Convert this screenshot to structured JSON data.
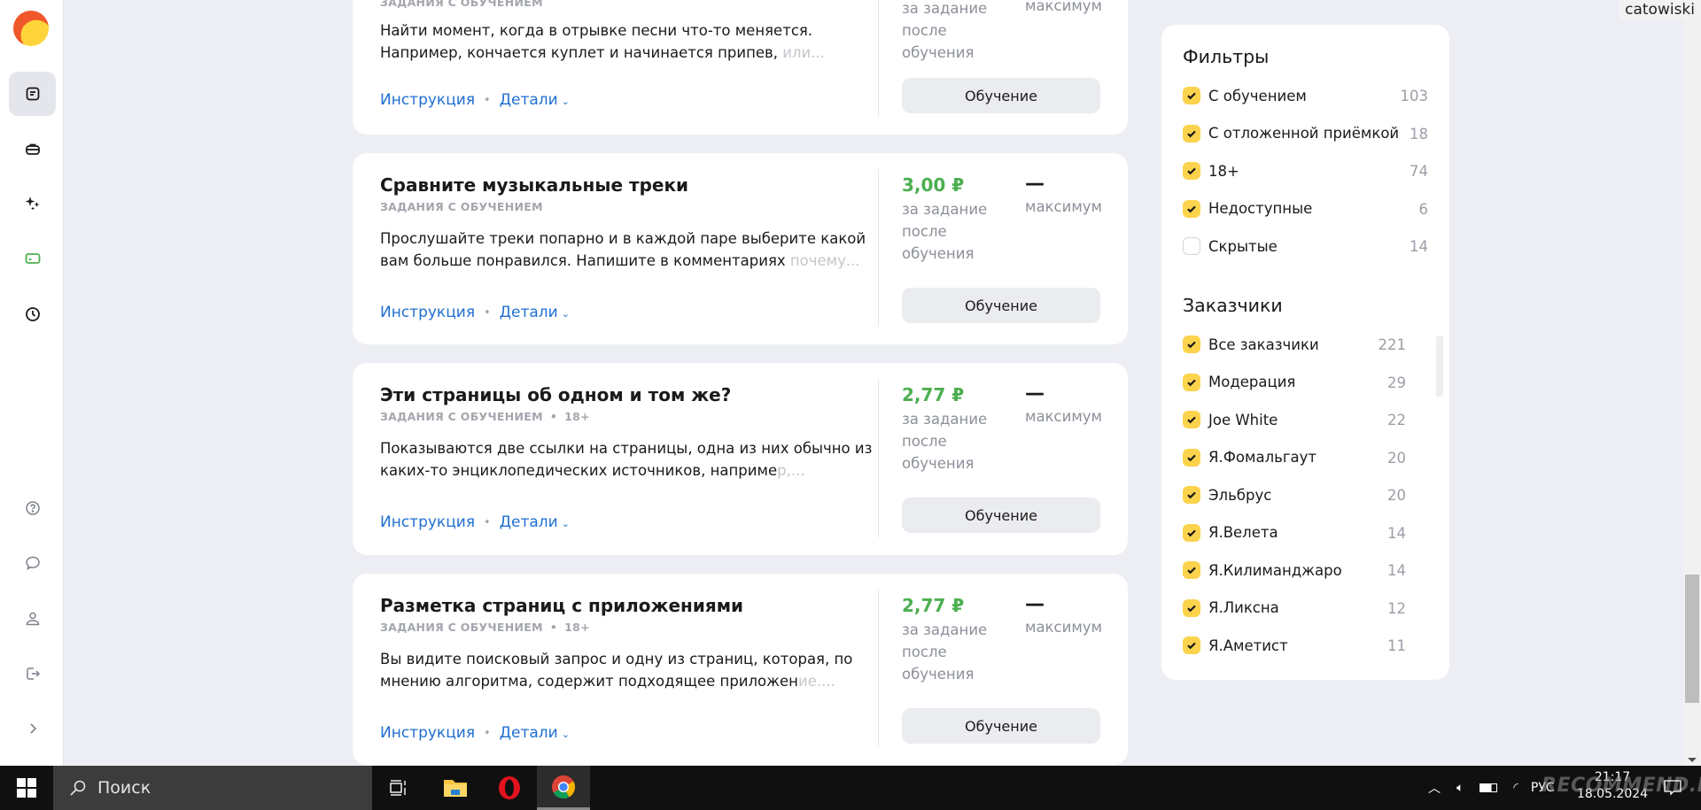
{
  "user": {
    "name": "catowiski"
  },
  "sidebar": {
    "top_items": [
      {
        "name": "tasks",
        "icon": "document-list-icon",
        "active": true
      },
      {
        "name": "portfolio",
        "icon": "briefcase-icon"
      },
      {
        "name": "skills",
        "icon": "sparkles-icon"
      },
      {
        "name": "payments",
        "icon": "credit-card-icon",
        "color": "#4caf50"
      },
      {
        "name": "history",
        "icon": "clock-icon"
      }
    ],
    "bottom_items": [
      {
        "name": "help",
        "icon": "question-circle-icon"
      },
      {
        "name": "messages",
        "icon": "chat-bubble-icon"
      },
      {
        "name": "profile",
        "icon": "user-icon"
      },
      {
        "name": "logout",
        "icon": "logout-icon"
      },
      {
        "name": "expand",
        "icon": "chevron-right-icon"
      }
    ]
  },
  "tasks": [
    {
      "title": "",
      "meta": "ЗАДАНИЯ С ОБУЧЕНИЕМ",
      "age": "",
      "description": "Найти момент, когда в отрывке песни что-то меняется. Например, кончается куплет и начинается припев,",
      "description_fade": " или...",
      "price": "",
      "price_sub": "за задание после обучения",
      "max_value": "",
      "max_label": "максимум",
      "instruction_link": "Инструкция",
      "details_link": "Детали",
      "button": "Обучение"
    },
    {
      "title": "Сравните музыкальные треки",
      "meta": "ЗАДАНИЯ С ОБУЧЕНИЕМ",
      "age": "",
      "description": "Прослушайте треки попарно и в каждой паре выберите какой вам больше понравился. Напишите в комментариях",
      "description_fade": " почему...",
      "price": "3,00 ₽",
      "price_sub": "за задание после обучения",
      "max_value": "—",
      "max_label": "максимум",
      "instruction_link": "Инструкция",
      "details_link": "Детали",
      "button": "Обучение"
    },
    {
      "title": "Эти страницы об одном и том же?",
      "meta": "ЗАДАНИЯ С ОБУЧЕНИЕМ",
      "age": "18+",
      "description": "Показываются две ссылки на страницы, одна из них обычно из каких-то энциклопедических источников, наприме",
      "description_fade": "р,...",
      "price": "2,77 ₽",
      "price_sub": "за задание после обучения",
      "max_value": "—",
      "max_label": "максимум",
      "instruction_link": "Инструкция",
      "details_link": "Детали",
      "button": "Обучение"
    },
    {
      "title": "Разметка страниц с приложениями",
      "meta": "ЗАДАНИЯ С ОБУЧЕНИЕМ",
      "age": "18+",
      "description": "Вы видите поисковый запрос и одну из страниц, которая, по мнению алгоритма, содержит подходящее приложен",
      "description_fade": "ие....",
      "price": "2,77 ₽",
      "price_sub": "за задание после обучения",
      "max_value": "—",
      "max_label": "максимум",
      "instruction_link": "Инструкция",
      "details_link": "Детали",
      "button": "Обучение"
    }
  ],
  "filters": {
    "title": "Фильтры",
    "items": [
      {
        "label": "С обучением",
        "count": "103",
        "checked": true
      },
      {
        "label": "С отложенной приёмкой",
        "count": "18",
        "checked": true
      },
      {
        "label": "18+",
        "count": "74",
        "checked": true
      },
      {
        "label": "Недоступные",
        "count": "6",
        "checked": true
      },
      {
        "label": "Скрытые",
        "count": "14",
        "checked": false
      }
    ]
  },
  "customers": {
    "title": "Заказчики",
    "items": [
      {
        "label": "Все заказчики",
        "count": "221",
        "checked": true
      },
      {
        "label": "Модерация",
        "count": "29",
        "checked": true
      },
      {
        "label": "Joe White",
        "count": "22",
        "checked": true
      },
      {
        "label": "Я.Фомальгаут",
        "count": "20",
        "checked": true
      },
      {
        "label": "Эльбрус",
        "count": "20",
        "checked": true
      },
      {
        "label": "Я.Велета",
        "count": "14",
        "checked": true
      },
      {
        "label": "Я.Килиманджаро",
        "count": "14",
        "checked": true
      },
      {
        "label": "Я.Ликсна",
        "count": "12",
        "checked": true
      },
      {
        "label": "Я.Аметист",
        "count": "11",
        "checked": true
      }
    ]
  },
  "taskbar": {
    "search_placeholder": "Поиск",
    "language": "РУС",
    "time": "21:17",
    "date": "18.05.2024",
    "watermark": "RECOMMEND.RU"
  },
  "colors": {
    "accent_check": "#fcd34d",
    "price_green": "#4caf50",
    "link_blue": "#1f6fd1"
  }
}
